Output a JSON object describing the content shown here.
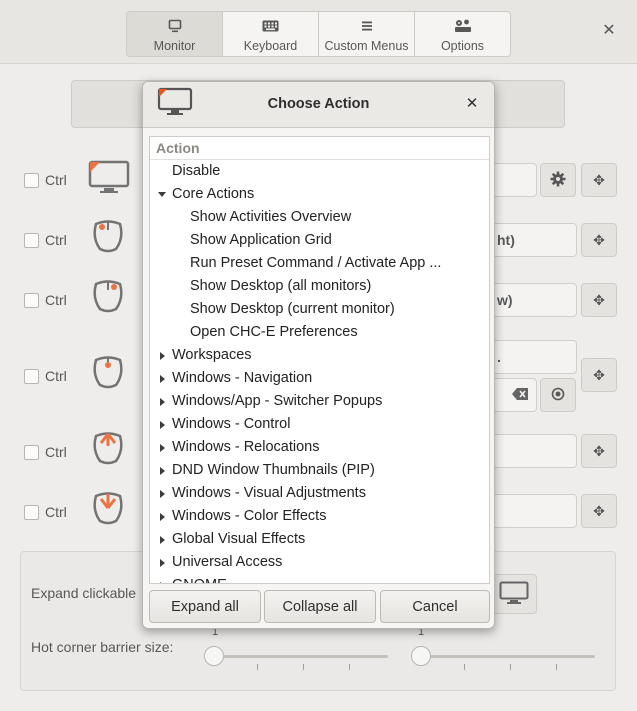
{
  "tabs": [
    {
      "label": "Monitor",
      "icon": "monitor-icon",
      "active": true
    },
    {
      "label": "Keyboard",
      "icon": "keyboard-icon",
      "active": false
    },
    {
      "label": "Custom Menus",
      "icon": "menu-icon",
      "active": false
    },
    {
      "label": "Options",
      "icon": "options-icon",
      "active": false
    }
  ],
  "background": {
    "rows": [
      {
        "modifier": "Ctrl",
        "trigger_icon": "monitor-corner-icon",
        "field_text": ""
      },
      {
        "modifier": "Ctrl",
        "trigger_icon": "mouse-left-click-icon",
        "field_text": "ht)"
      },
      {
        "modifier": "Ctrl",
        "trigger_icon": "mouse-right-click-icon",
        "field_text": "w)"
      },
      {
        "modifier": "Ctrl",
        "trigger_icon": "mouse-middle-click-icon",
        "field_text": "."
      },
      {
        "modifier": "Ctrl",
        "trigger_icon": "mouse-scroll-up-icon",
        "field_text": ""
      },
      {
        "modifier": "Ctrl",
        "trigger_icon": "mouse-scroll-down-icon",
        "field_text": ""
      }
    ],
    "expand_label": "Expand clickable",
    "barrier_label": "Hot corner barrier size:",
    "slider1_value": "1",
    "slider2_value": "1"
  },
  "dialog": {
    "title": "Choose Action",
    "column_header": "Action",
    "items": [
      {
        "label": "Disable",
        "level": 0,
        "expander": "none"
      },
      {
        "label": "Core Actions",
        "level": 0,
        "expander": "expanded"
      },
      {
        "label": "Show Activities Overview",
        "level": 1,
        "expander": "none"
      },
      {
        "label": "Show Application Grid",
        "level": 1,
        "expander": "none"
      },
      {
        "label": "Run Preset Command / Activate App ...",
        "level": 1,
        "expander": "none"
      },
      {
        "label": "Show Desktop (all monitors)",
        "level": 1,
        "expander": "none"
      },
      {
        "label": "Show Desktop (current monitor)",
        "level": 1,
        "expander": "none"
      },
      {
        "label": "Open CHC-E Preferences",
        "level": 1,
        "expander": "none"
      },
      {
        "label": "Workspaces",
        "level": 0,
        "expander": "collapsed"
      },
      {
        "label": "Windows - Navigation",
        "level": 0,
        "expander": "collapsed"
      },
      {
        "label": "Windows/App - Switcher Popups",
        "level": 0,
        "expander": "collapsed"
      },
      {
        "label": "Windows - Control",
        "level": 0,
        "expander": "collapsed"
      },
      {
        "label": "Windows - Relocations",
        "level": 0,
        "expander": "collapsed"
      },
      {
        "label": "DND Window Thumbnails (PIP)",
        "level": 0,
        "expander": "collapsed"
      },
      {
        "label": "Windows - Visual Adjustments",
        "level": 0,
        "expander": "collapsed"
      },
      {
        "label": "Windows - Color Effects",
        "level": 0,
        "expander": "collapsed"
      },
      {
        "label": "Global Visual Effects",
        "level": 0,
        "expander": "collapsed"
      },
      {
        "label": "Universal Access",
        "level": 0,
        "expander": "collapsed"
      },
      {
        "label": "GNOME",
        "level": 0,
        "expander": "collapsed"
      }
    ],
    "buttons": {
      "expand_all": "Expand all",
      "collapse_all": "Collapse all",
      "cancel": "Cancel"
    }
  },
  "colors": {
    "accent_orange": "#e9541a",
    "icon_gray": "#555555"
  }
}
